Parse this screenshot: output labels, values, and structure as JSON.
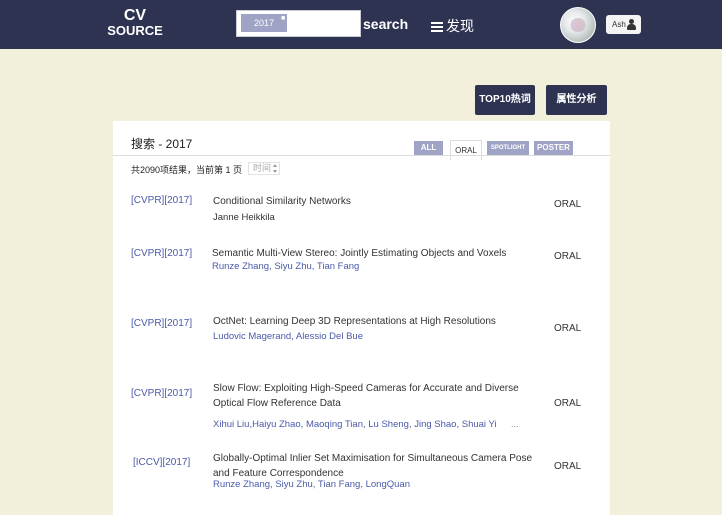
{
  "navbar": {
    "logo_line1": "CV",
    "logo_line2": "SOURCE",
    "search_tag": "2017",
    "search_input_value": "",
    "search_label": "search",
    "discover_label": "发现",
    "user_label": "Ash",
    "background": "#2e3352"
  },
  "actions": {
    "top10_label": "TOP10热词",
    "attr_label": "属性分析"
  },
  "panel": {
    "title": "搜索 - 2017",
    "filters": {
      "all": "ALL",
      "oral": "ORAL",
      "spotlight": "SPOTLIGHT",
      "poster": "POSTER"
    },
    "result_info": "共2090项结果，当前第 1 页",
    "sort_value": "时间",
    "results": [
      {
        "venue": "[CVPR][2017]",
        "title": "Conditional Similarity Networks",
        "authors": "Janne Heikkila",
        "type": "ORAL"
      },
      {
        "venue": "[CVPR][2017]",
        "title": "Semantic Multi-View Stereo: Jointly Estimating Objects and Voxels",
        "authors": "Runze Zhang, Siyu Zhu, Tian Fang",
        "type": "ORAL"
      },
      {
        "venue": "[CVPR][2017]",
        "title": "OctNet: Learning Deep 3D Representations at High Resolutions",
        "authors": "Ludovic Magerand, Alessio Del Bue",
        "type": "ORAL"
      },
      {
        "venue": "[CVPR][2017]",
        "title": "Slow Flow: Exploiting High-Speed Cameras for Accurate and Diverse Optical Flow Reference Data",
        "authors": "Xihui Liu,Haiyu Zhao, Maoqing Tian, Lu Sheng, Jing Shao, Shuai Yi",
        "ellipsis": "...",
        "type": "ORAL"
      },
      {
        "venue": "[ICCV][2017]",
        "title": "Globally-Optimal Inlier Set Maximisation for Simultaneous Camera Pose and Feature Correspondence",
        "authors": "Runze Zhang, Siyu Zhu, Tian Fang, LongQuan",
        "type": "ORAL"
      }
    ]
  },
  "colors": {
    "page_background": "#f2efdb",
    "accent_link": "#4a5aa8",
    "filter_chip": "#9fa3c6"
  }
}
